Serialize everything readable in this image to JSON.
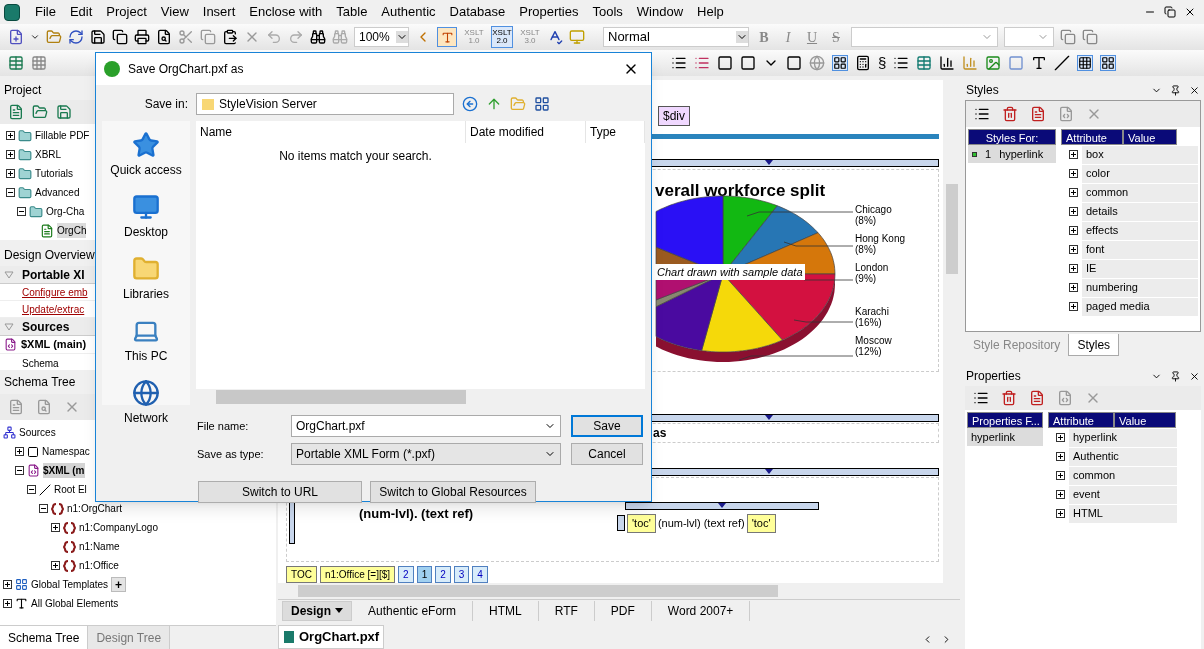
{
  "menu_bar": {
    "items": [
      "File",
      "Edit",
      "Project",
      "View",
      "Insert",
      "Enclose with",
      "Table",
      "Authentic",
      "Database",
      "Properties",
      "Tools",
      "Window",
      "Help"
    ]
  },
  "toolbar": {
    "zoom": "100%",
    "xslt": [
      {
        "name": "XSLT",
        "version": "1.0",
        "selected": false
      },
      {
        "name": "XSLT",
        "version": "2.0",
        "selected": true
      },
      {
        "name": "XSLT",
        "version": "3.0",
        "selected": false
      }
    ],
    "paragraph_style": "Normal",
    "format_buttons": [
      "B",
      "I",
      "U",
      "S"
    ],
    "section_sign": "§"
  },
  "project": {
    "title": "Project",
    "tree": [
      {
        "label": "Fillable PDF",
        "expanded": false,
        "kind": "folder"
      },
      {
        "label": "XBRL",
        "expanded": false,
        "kind": "folder"
      },
      {
        "label": "Tutorials",
        "expanded": false,
        "kind": "folder"
      },
      {
        "label": "Advanced",
        "expanded": true,
        "kind": "folder",
        "children": [
          {
            "label": "Org-Cha",
            "expanded": true,
            "kind": "folder",
            "children": [
              {
                "label": "OrgCh",
                "kind": "file",
                "selected": true
              }
            ]
          }
        ]
      }
    ]
  },
  "design_overview": {
    "title": "Design Overview",
    "sections": [
      {
        "title": "Portable XI",
        "expanded": true,
        "rows": [
          {
            "kind": "link",
            "label": "Configure emb"
          },
          {
            "kind": "link",
            "label": "Update/extrac"
          }
        ]
      },
      {
        "title": "Sources",
        "expanded": true,
        "rows": [
          {
            "kind": "source",
            "label": "$XML (main)"
          },
          {
            "kind": "plain",
            "label": "Schema"
          }
        ]
      }
    ]
  },
  "schema_tree": {
    "title": "Schema Tree",
    "tree": [
      {
        "label": "Sources",
        "kind": "sources",
        "children": [
          {
            "label": "Namespac",
            "kind": "namespace",
            "expanded": false
          },
          {
            "label": "$XML (m",
            "kind": "xml",
            "expanded": true,
            "selected": true,
            "children": [
              {
                "label": "Root El",
                "kind": "root",
                "expanded": true,
                "children": [
                  {
                    "label": "n1:OrgChart",
                    "kind": "element",
                    "expanded": true,
                    "children": [
                      {
                        "label": "n1:CompanyLogo",
                        "kind": "element",
                        "expanded": false
                      },
                      {
                        "label": "n1:Name",
                        "kind": "element"
                      },
                      {
                        "label": "n1:Office",
                        "kind": "element",
                        "expanded": false
                      }
                    ]
                  }
                ]
              }
            ]
          }
        ]
      },
      {
        "label": "Global Templates",
        "kind": "templates",
        "expanded": false,
        "add_button": "+"
      },
      {
        "label": "All Global Elements",
        "kind": "globals",
        "expanded": false
      }
    ],
    "tabs": [
      {
        "label": "Schema Tree",
        "selected": true
      },
      {
        "label": "Design Tree",
        "selected": false
      }
    ]
  },
  "design": {
    "div_tag": "$div",
    "chart_title": "verall workforce split",
    "chart_note": "Chart drawn with sample data",
    "chart_labels": [
      {
        "name": "Chicago",
        "share": "(8%)"
      },
      {
        "name": "Hong Kong",
        "share": "(8%)"
      },
      {
        "name": "London",
        "share": "(9%)"
      },
      {
        "name": "Karachi",
        "share": "(16%)"
      },
      {
        "name": "Moscow",
        "share": "(12%)"
      }
    ],
    "text_fragment": "as",
    "toc_left": "(num-lvl). (text ref)",
    "toc_row": [
      {
        "kind": "tag",
        "label": "'toc'"
      },
      {
        "kind": "text",
        "label": "(num-lvl) (text ref)"
      },
      {
        "kind": "tag",
        "label": "'toc'"
      }
    ],
    "bottom_tags": [
      {
        "kind": "tag",
        "label": "TOC"
      },
      {
        "kind": "tag",
        "label": "n1:Office [=][$]"
      },
      {
        "kind": "page",
        "label": "2",
        "selected": false
      },
      {
        "kind": "page",
        "label": "1",
        "selected": true
      },
      {
        "kind": "page",
        "label": "2",
        "selected": false
      },
      {
        "kind": "page",
        "label": "3",
        "selected": false
      },
      {
        "kind": "page",
        "label": "4",
        "selected": false
      }
    ],
    "view_tabs": [
      {
        "label": "Design",
        "selected": true
      },
      {
        "label": "Authentic eForm",
        "selected": false
      },
      {
        "label": "HTML",
        "selected": false
      },
      {
        "label": "RTF",
        "selected": false
      },
      {
        "label": "PDF",
        "selected": false
      },
      {
        "label": "Word 2007+",
        "selected": false
      }
    ],
    "file_tab": "OrgChart.pxf"
  },
  "styles": {
    "title": "Styles",
    "for_header": "Styles For:",
    "items": [
      {
        "index": "1",
        "name": "hyperlink"
      }
    ],
    "columns": [
      "Attribute",
      "Value"
    ],
    "attributes": [
      "box",
      "color",
      "common",
      "details",
      "effects",
      "font",
      "IE",
      "numbering",
      "paged media"
    ],
    "tabs": [
      {
        "label": "Style Repository",
        "selected": false
      },
      {
        "label": "Styles",
        "selected": true
      }
    ]
  },
  "properties": {
    "title": "Properties",
    "for_header": "Properties F...",
    "items": [
      "hyperlink"
    ],
    "columns": [
      "Attribute",
      "Value"
    ],
    "attributes": [
      "hyperlink",
      "Authentic",
      "common",
      "event",
      "HTML"
    ]
  },
  "dialog": {
    "title": "Save OrgChart.pxf as",
    "save_in_label": "Save in:",
    "save_in": "StyleVision Server",
    "places": [
      {
        "label": "Quick access",
        "kind": "star"
      },
      {
        "label": "Desktop",
        "kind": "desktop"
      },
      {
        "label": "Libraries",
        "kind": "library"
      },
      {
        "label": "This PC",
        "kind": "pc"
      },
      {
        "label": "Network",
        "kind": "network"
      }
    ],
    "columns": [
      "Name",
      "Date modified",
      "Type"
    ],
    "empty_message": "No items match your search.",
    "file_name_label": "File name:",
    "file_name": "OrgChart.pxf",
    "type_label": "Save as type:",
    "type": "Portable XML Form (*.pxf)",
    "buttons": [
      "Save",
      "Cancel"
    ],
    "switch_buttons": [
      "Switch to URL",
      "Switch to Global Resources"
    ]
  }
}
